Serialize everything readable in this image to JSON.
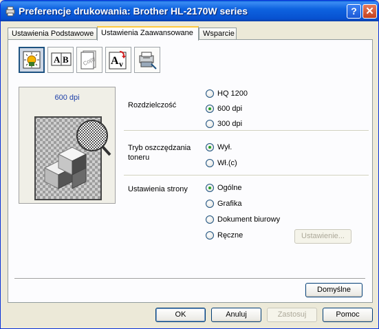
{
  "window": {
    "title": "Preferencje drukowania: Brother HL-2170W series",
    "help_label": "?",
    "close_label": "✕"
  },
  "tabs": [
    {
      "label": "Ustawienia Podstawowe",
      "active": false
    },
    {
      "label": "Ustawienia Zaawansowane",
      "active": true
    },
    {
      "label": "Wsparcie",
      "active": false
    }
  ],
  "feature_icons": [
    {
      "name": "print-quality-icon",
      "selected": true
    },
    {
      "name": "ab-text-icon",
      "selected": false
    },
    {
      "name": "copy-icon",
      "selected": false
    },
    {
      "name": "font-ay-icon",
      "selected": false
    },
    {
      "name": "device-options-icon",
      "selected": false
    }
  ],
  "preview": {
    "resolution_label": "600 dpi"
  },
  "resolution": {
    "label": "Rozdzielczość",
    "options": [
      "HQ 1200",
      "600 dpi",
      "300 dpi"
    ],
    "selected": "600 dpi"
  },
  "toner_save": {
    "label_line1": "Tryb oszczędzania",
    "label_line2": "toneru",
    "options": [
      "Wył.",
      "Wł.(c)"
    ],
    "selected": "Wył."
  },
  "page_settings": {
    "label": "Ustawienia strony",
    "options": [
      "Ogólne",
      "Grafika",
      "Dokument biurowy",
      "Ręczne"
    ],
    "selected": "Ogólne",
    "settings_button": "Ustawienie..."
  },
  "defaults_button": "Domyślne",
  "footer": {
    "ok": "OK",
    "cancel": "Anuluj",
    "apply": "Zastosuj",
    "help": "Pomoc"
  },
  "colors": {
    "titlebar": "#0751d0",
    "active_tab_accent": "#ffc83c",
    "radio_dot": "#21a121",
    "preview_label": "#1d3fa8"
  }
}
